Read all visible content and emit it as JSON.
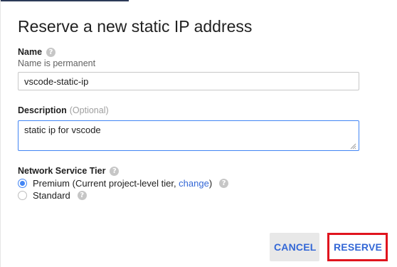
{
  "dialog": {
    "title": "Reserve a new static IP address"
  },
  "name_field": {
    "label": "Name",
    "hint": "Name is permanent",
    "value": "vscode-static-ip",
    "help_icon": "question-circle-icon"
  },
  "description_field": {
    "label": "Description",
    "optional_label": "(Optional)",
    "value": "static ip for vscode"
  },
  "network_tier": {
    "label": "Network Service Tier",
    "help_icon": "question-circle-icon",
    "options": [
      {
        "label_prefix": "Premium (Current project-level tier, ",
        "link_text": "change",
        "label_suffix": ")",
        "selected": true
      },
      {
        "label": "Standard",
        "selected": false
      }
    ]
  },
  "actions": {
    "cancel_label": "CANCEL",
    "reserve_label": "RESERVE"
  },
  "colors": {
    "accent": "#4285f4",
    "link": "#3367d6",
    "highlight_border": "#e0141e"
  }
}
